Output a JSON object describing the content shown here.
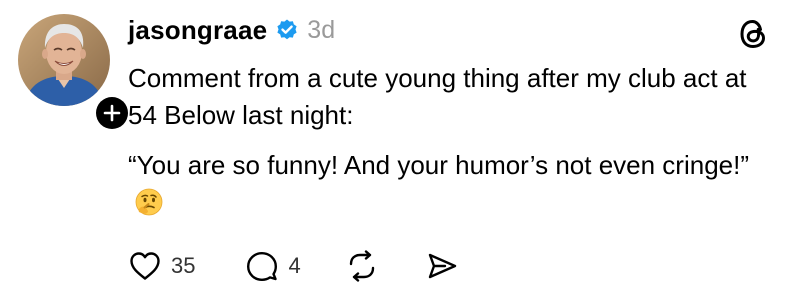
{
  "post": {
    "username": "jasongraae",
    "timestamp": "3d",
    "paragraphs": [
      "Comment from a cute young thing after my club act at 54 Below last night:",
      "“You are so funny! And your humor’s not even cringe!”"
    ],
    "emoji": "thinking-face",
    "likes": "35",
    "replies": "4"
  },
  "icons": {
    "verified": "verified-badge-icon",
    "app": "threads-logo-icon",
    "follow": "plus-icon",
    "like": "heart-icon",
    "reply": "comment-icon",
    "repost": "repost-icon",
    "share": "send-icon"
  },
  "colors": {
    "verified_blue": "#1D9BF0",
    "timestamp_gray": "#9a9a9a",
    "text": "#000000"
  }
}
